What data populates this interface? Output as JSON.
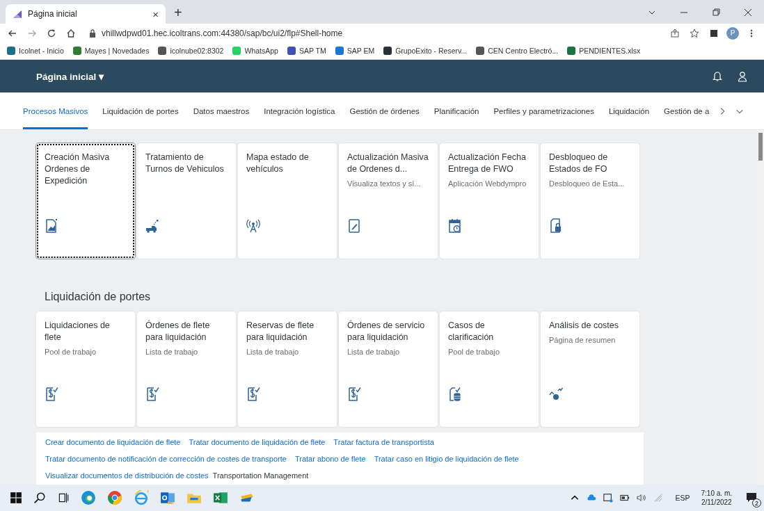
{
  "browser": {
    "tab_title": "Página inicial",
    "tab_close": "×",
    "new_tab": "+",
    "url": "vhillwdpwd01.hec.icoltrans.com:44380/sap/bc/ui2/flp#Shell-home",
    "profile_initial": "P",
    "bookmarks": [
      {
        "label": "Icolnet - Inicio",
        "color": "#1f6f8b"
      },
      {
        "label": "Mayes | Novedades",
        "color": "#2e7d32"
      },
      {
        "label": "icolnube02:8302",
        "color": "#555555"
      },
      {
        "label": "WhatsApp",
        "color": "#25d366"
      },
      {
        "label": "SAP TM",
        "color": "#3f51b5"
      },
      {
        "label": "SAP EM",
        "color": "#1976d2"
      },
      {
        "label": "GrupoExito - Reserv...",
        "color": "#263238"
      },
      {
        "label": "CEN Centro Electró...",
        "color": "#555555"
      },
      {
        "label": "PENDIENTES.xlsx",
        "color": "#1e7145"
      }
    ]
  },
  "shell": {
    "title": "Página inicial ▾"
  },
  "nav_tabs": [
    {
      "label": "Procesos Masivos",
      "selected": true
    },
    {
      "label": "Liquidación de portes",
      "selected": false
    },
    {
      "label": "Datos maestros",
      "selected": false
    },
    {
      "label": "Integración logística",
      "selected": false
    },
    {
      "label": "Gestión de órdenes",
      "selected": false
    },
    {
      "label": "Planificación",
      "selected": false
    },
    {
      "label": "Perfiles y parametrizaciones",
      "selected": false
    },
    {
      "label": "Liquidación",
      "selected": false
    },
    {
      "label": "Gestión de a",
      "selected": false
    }
  ],
  "groups": [
    {
      "tiles": [
        {
          "title": "Creación Masiva Ordenes de Expedición",
          "kind": "doc-chart",
          "focused": true
        },
        {
          "title": "Tratamiento de Turnos de Vehiculos",
          "kind": "truck",
          "focused": false
        },
        {
          "title": "Mapa estado de vehículos",
          "kind": "antenna",
          "focused": false
        },
        {
          "title": "Actualización Masiva de Ordenes d...",
          "subtitle": "Visualiza textos y sí...",
          "kind": "doc-edit",
          "focused": false
        },
        {
          "title": "Actualización Fecha Entrega de FWO",
          "subtitle": "Aplicación Webdympro",
          "kind": "calendar",
          "focused": false
        },
        {
          "title": "Desbloqueo de Estados de FO",
          "subtitle": "Desbloqueo de Esta...",
          "kind": "doc-lock",
          "focused": false
        }
      ]
    },
    {
      "title": "Liquidación de portes",
      "tiles": [
        {
          "title": "Liquidaciones de flete",
          "subtitle": "Pool de trabajo",
          "kind": "doc-dollar",
          "focused": false
        },
        {
          "title": "Órdenes de flete para liquidación",
          "subtitle": "Lista de trabajo",
          "kind": "doc-dollar",
          "focused": false
        },
        {
          "title": "Reservas de flete para liquidación",
          "subtitle": "Lista de trabajo",
          "kind": "doc-dollar",
          "focused": false
        },
        {
          "title": "Órdenes de servicio para liquidación",
          "subtitle": "Lista de trabajo",
          "kind": "doc-dollar",
          "focused": false
        },
        {
          "title": "Casos de clarificación",
          "subtitle": "Pool de trabajo",
          "kind": "doc-db",
          "focused": false
        },
        {
          "title": "Análisis de costes",
          "subtitle": "Página de resumen",
          "kind": "trend-dollar",
          "focused": false
        }
      ],
      "links": [
        [
          {
            "kind": "link",
            "text": "Crear documento de liquidación de flete"
          },
          {
            "kind": "link",
            "text": "Tratar documento de liquidación de flete"
          },
          {
            "kind": "link",
            "text": "Tratar factura de transportista"
          }
        ],
        [
          {
            "kind": "link",
            "text": "Tratar documento de notificación de corrección de costes de transporte"
          },
          {
            "kind": "link",
            "text": "Tratar abono de flete"
          },
          {
            "kind": "link",
            "text": "Tratar caso en litigio de liquidación de flete"
          }
        ],
        [
          {
            "kind": "link",
            "text": "Visualizar documentos de distribución de costes"
          },
          {
            "kind": "text",
            "text": "Transportation Management"
          }
        ]
      ]
    }
  ],
  "taskbar": {
    "language": "ESP",
    "time": "7:10 a. m.",
    "date": "2/11/2022",
    "notifications": "2"
  }
}
